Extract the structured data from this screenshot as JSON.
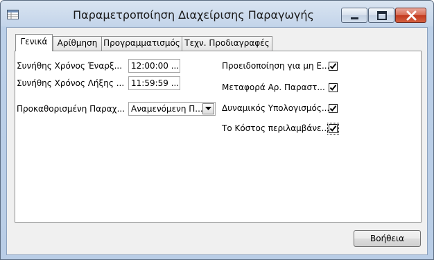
{
  "window": {
    "title": "Παραμετροποίηση Διαχείρισης Παραγωγής",
    "icon": "table-window-icon",
    "controls": [
      "minimize-icon",
      "maximize-icon",
      "close-icon"
    ]
  },
  "tabs": [
    {
      "label": "Γενικά",
      "active": true
    },
    {
      "label": "Αρίθμηση",
      "active": false
    },
    {
      "label": "Προγραμματισμός",
      "active": false
    },
    {
      "label": "Τεχν. Προδιαγραφές",
      "active": false
    }
  ],
  "general": {
    "start_time": {
      "label": "Συνήθης Χρόνος Έναρξ...",
      "value": "12:00:00 ..."
    },
    "end_time": {
      "label": "Συνήθης Χρόνος Λήξης ...",
      "value": "11:59:59 ..."
    },
    "default_flush": {
      "label": "Προκαθορισμένη Παραχ...",
      "value": "Αναμενόμενη Π..."
    },
    "checkboxes": [
      {
        "label": "Προειδοποίηση για μη Ε...",
        "checked": true
      },
      {
        "label": "Μεταφορά Αρ. Παραστ...",
        "checked": true
      },
      {
        "label": "Δυναμικός Υπολογισμός...",
        "checked": true
      },
      {
        "label": "Το Κόστος περιλαμβάνε...",
        "checked": true,
        "focused": true
      }
    ]
  },
  "footer": {
    "help_label": "Βοήθεια"
  }
}
